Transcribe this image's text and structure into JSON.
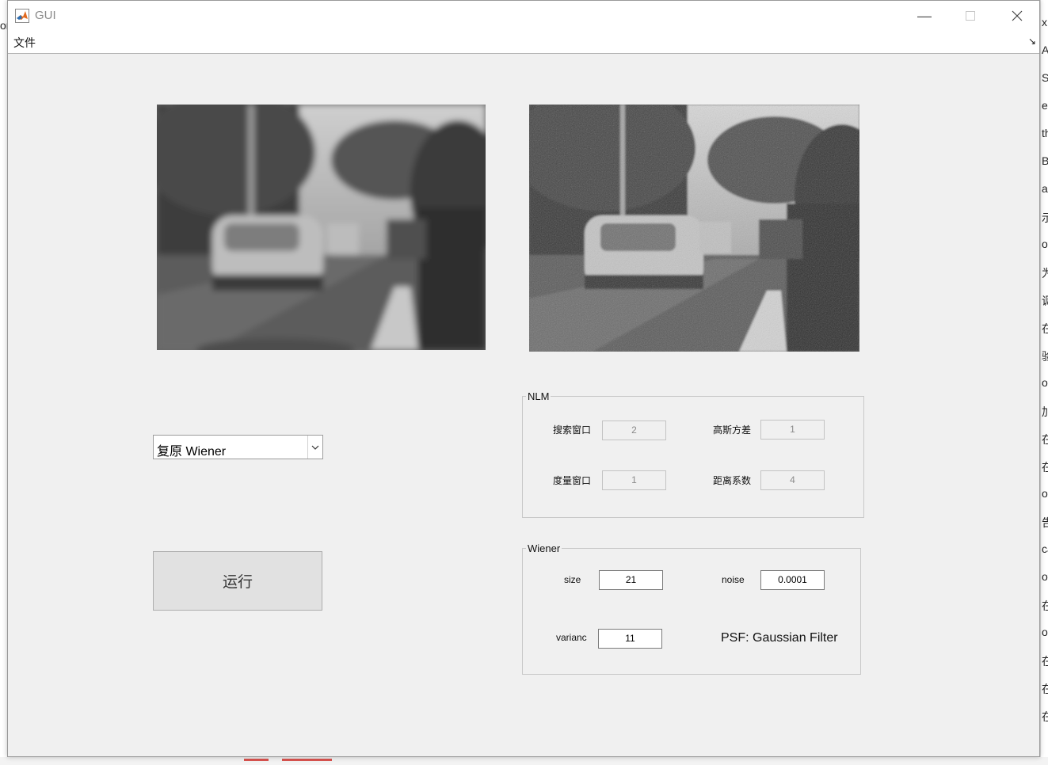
{
  "window": {
    "title": "GUI"
  },
  "menu": {
    "file": "文件"
  },
  "method_select": {
    "value": "复原 Wiener"
  },
  "run_button": {
    "label": "运行"
  },
  "nlm_panel": {
    "title": "NLM",
    "search_window_label": "搜索窗口",
    "search_window_value": "2",
    "gauss_var_label": "高斯方差",
    "gauss_var_value": "1",
    "measure_window_label": "度量窗口",
    "measure_window_value": "1",
    "distance_coef_label": "距离系数",
    "distance_coef_value": "4"
  },
  "wiener_panel": {
    "title": "Wiener",
    "size_label": "size",
    "size_value": "21",
    "noise_label": "noise",
    "noise_value": "0.0001",
    "varianc_label": "varianc",
    "varianc_value": "11",
    "psf_text": "PSF: Gaussian Filter"
  },
  "background_right_chars": [
    "x",
    "A",
    "S",
    "e",
    "th",
    "B",
    "a",
    "示",
    "ot",
    "为",
    "调",
    "在",
    "验",
    "os",
    "加",
    "在",
    "在",
    "os",
    "告",
    "ca",
    "ot",
    "在",
    "oa",
    "在",
    "在",
    "在"
  ]
}
